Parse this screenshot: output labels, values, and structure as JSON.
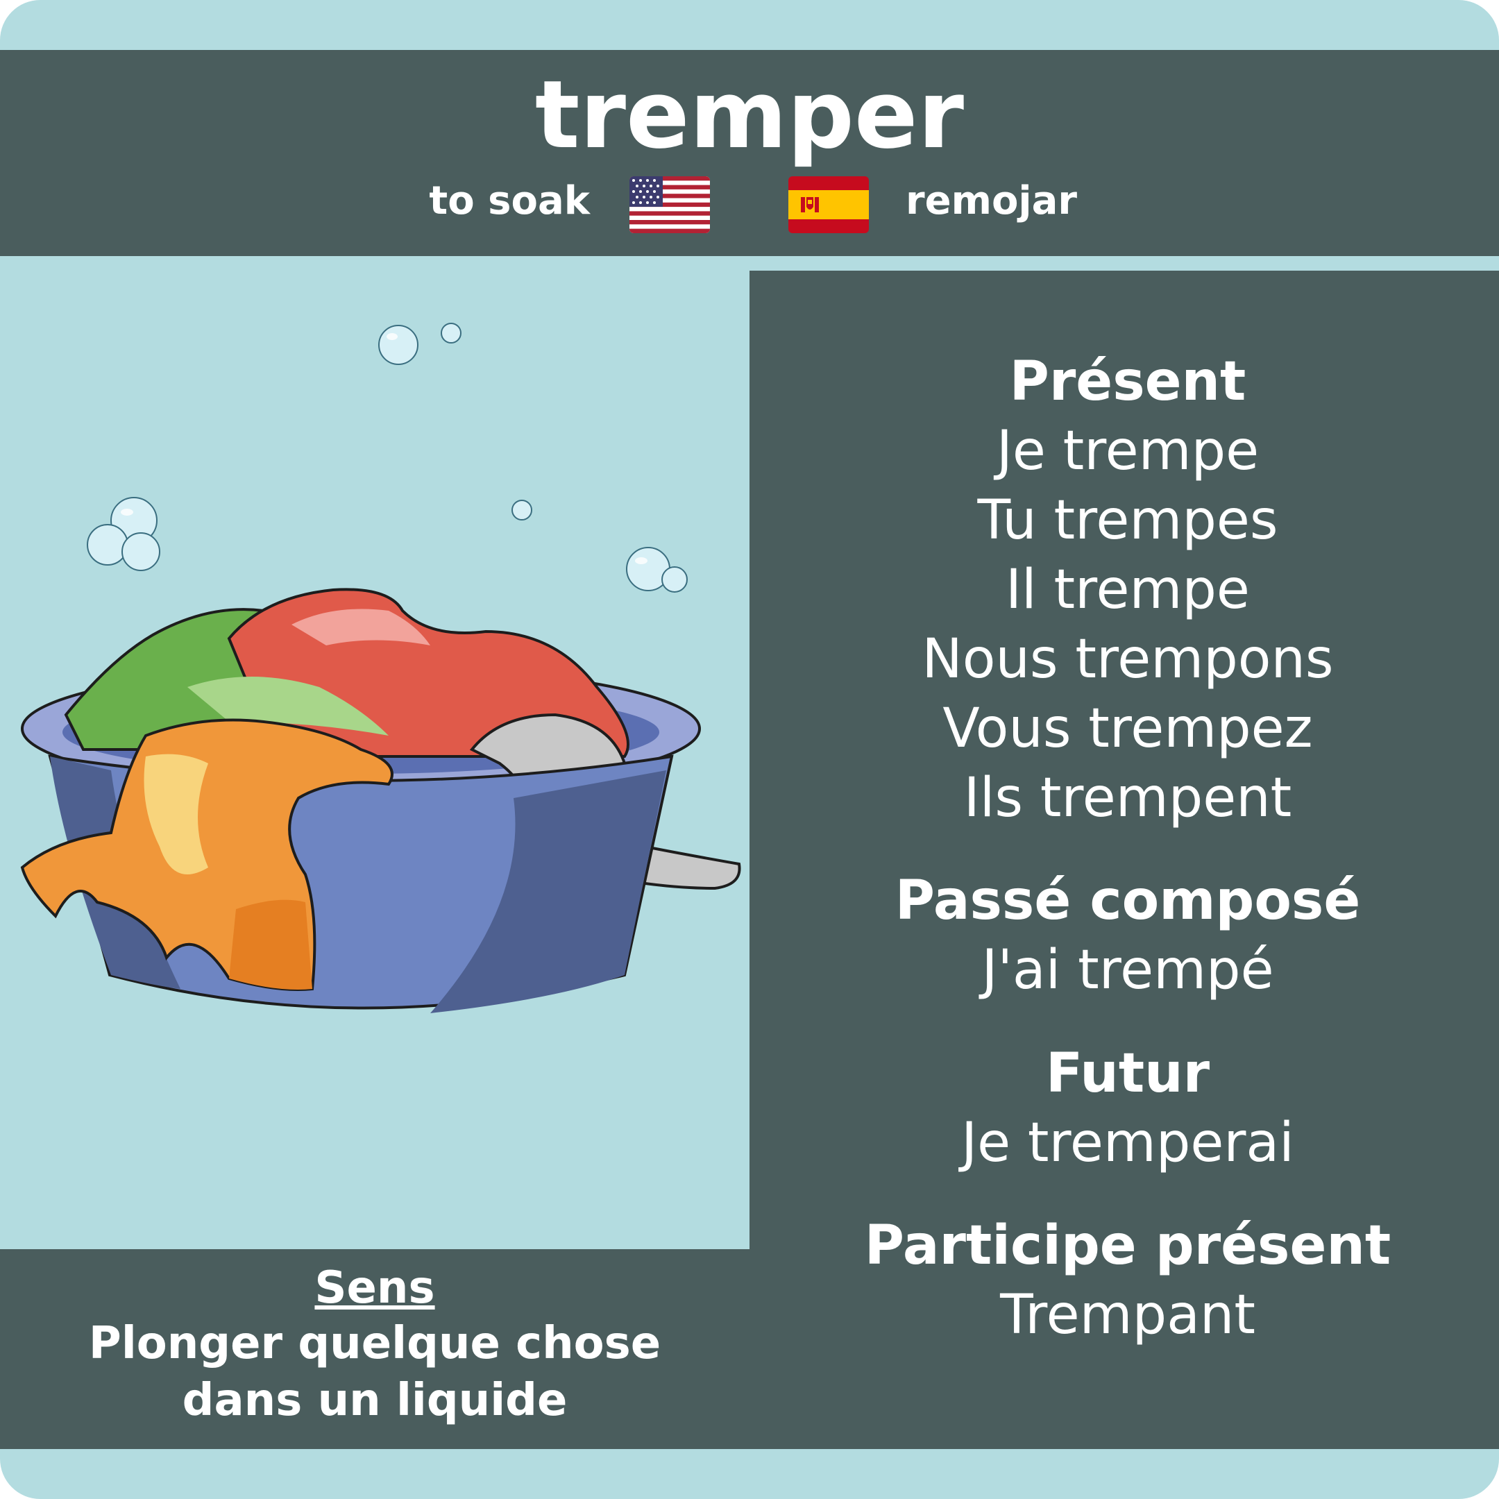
{
  "card": {
    "word": "tremper",
    "translation_en": "to soak",
    "translation_es": "remojar",
    "flag_en": "us-flag-icon",
    "flag_es": "spain-flag-icon"
  },
  "colors": {
    "background": "#b3dce0",
    "panel": "#4a5d5d",
    "text": "#ffffff"
  },
  "illustration": {
    "icon": "laundry-basin-icon"
  },
  "conjugation": {
    "present": {
      "heading": "Présent",
      "lines": [
        "Je trempe",
        "Tu trempes",
        "Il trempe",
        "Nous trempons",
        "Vous trempez",
        "Ils trempent"
      ]
    },
    "passe_compose": {
      "heading": "Passé composé",
      "line": "J'ai trempé"
    },
    "futur": {
      "heading": "Futur",
      "line": "Je tremperai"
    },
    "participe_present": {
      "heading": "Participe présent",
      "line": "Trempant"
    }
  },
  "meaning": {
    "title": "Sens",
    "lines": [
      "Plonger quelque chose",
      "dans un liquide"
    ]
  }
}
